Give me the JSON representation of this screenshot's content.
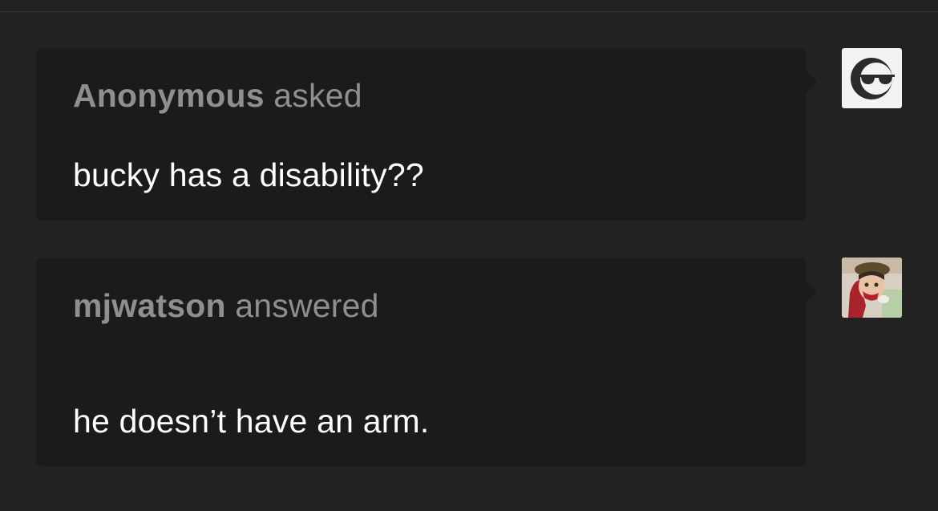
{
  "posts": {
    "ask": {
      "author": "Anonymous",
      "action": "asked",
      "text": "bucky has a disability??",
      "avatar_icon": "anonymous-sunglasses-icon"
    },
    "answer": {
      "author": "mjwatson",
      "action": "answered",
      "text": "he doesn’t have an arm.",
      "avatar_icon": "user-avatar-image"
    }
  },
  "colors": {
    "background": "#222222",
    "bubble": "#1b1b1b",
    "header_text": "#8f8f8f",
    "body_text": "#ffffff"
  }
}
